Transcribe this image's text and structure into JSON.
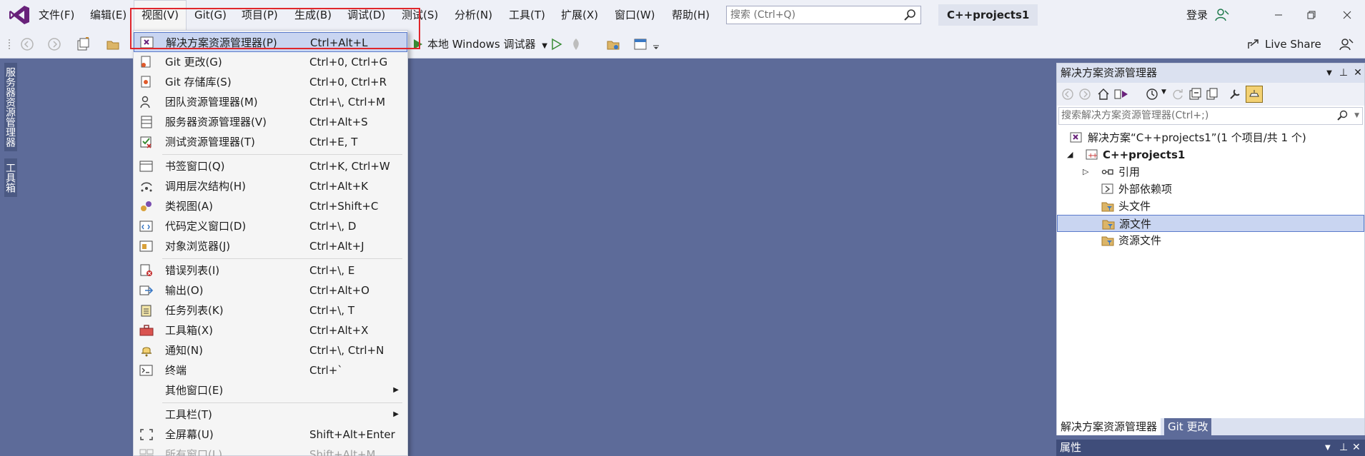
{
  "titlebar": {
    "menus": [
      "文件(F)",
      "编辑(E)",
      "视图(V)",
      "Git(G)",
      "项目(P)",
      "生成(B)",
      "调试(D)",
      "测试(S)",
      "分析(N)",
      "工具(T)",
      "扩展(X)",
      "窗口(W)",
      "帮助(H)"
    ],
    "search_placeholder": "搜索 (Ctrl+Q)",
    "project_name": "C++projects1",
    "signin": "登录"
  },
  "toolbar": {
    "debug_target": "本地 Windows 调试器",
    "live_share": "Live Share"
  },
  "left_tabs": [
    "服务器资源管理器",
    "工具箱"
  ],
  "view_menu": {
    "items": [
      {
        "label": "解决方案资源管理器(P)",
        "shortcut": "Ctrl+Alt+L",
        "icon": "solution-explorer-icon"
      },
      {
        "label": "Git 更改(G)",
        "shortcut": "Ctrl+0, Ctrl+G",
        "icon": "git-changes-icon"
      },
      {
        "label": "Git 存储库(S)",
        "shortcut": "Ctrl+0, Ctrl+R",
        "icon": "git-repository-icon"
      },
      {
        "label": "团队资源管理器(M)",
        "shortcut": "Ctrl+\\, Ctrl+M",
        "icon": "team-explorer-icon"
      },
      {
        "label": "服务器资源管理器(V)",
        "shortcut": "Ctrl+Alt+S",
        "icon": "server-explorer-icon"
      },
      {
        "label": "测试资源管理器(T)",
        "shortcut": "Ctrl+E, T",
        "icon": "test-explorer-icon"
      },
      {
        "label": "书签窗口(Q)",
        "shortcut": "Ctrl+K, Ctrl+W",
        "icon": "bookmark-icon"
      },
      {
        "label": "调用层次结构(H)",
        "shortcut": "Ctrl+Alt+K",
        "icon": "call-hierarchy-icon"
      },
      {
        "label": "类视图(A)",
        "shortcut": "Ctrl+Shift+C",
        "icon": "class-view-icon"
      },
      {
        "label": "代码定义窗口(D)",
        "shortcut": "Ctrl+\\, D",
        "icon": "code-definition-icon"
      },
      {
        "label": "对象浏览器(J)",
        "shortcut": "Ctrl+Alt+J",
        "icon": "object-browser-icon"
      },
      {
        "label": "错误列表(I)",
        "shortcut": "Ctrl+\\, E",
        "icon": "error-list-icon"
      },
      {
        "label": "输出(O)",
        "shortcut": "Ctrl+Alt+O",
        "icon": "output-icon"
      },
      {
        "label": "任务列表(K)",
        "shortcut": "Ctrl+\\, T",
        "icon": "task-list-icon"
      },
      {
        "label": "工具箱(X)",
        "shortcut": "Ctrl+Alt+X",
        "icon": "toolbox-icon"
      },
      {
        "label": "通知(N)",
        "shortcut": "Ctrl+\\, Ctrl+N",
        "icon": "bell-icon"
      },
      {
        "label": "终端",
        "shortcut": "Ctrl+`",
        "icon": "terminal-icon"
      },
      {
        "label": "其他窗口(E)",
        "shortcut": "",
        "icon": ""
      },
      {
        "label": "工具栏(T)",
        "shortcut": "",
        "icon": ""
      },
      {
        "label": "全屏幕(U)",
        "shortcut": "Shift+Alt+Enter",
        "icon": "fullscreen-icon"
      },
      {
        "label": "所有窗口(L)",
        "shortcut": "Shift+Alt+M",
        "icon": "all-windows-icon"
      }
    ]
  },
  "solution_explorer": {
    "title": "解决方案资源管理器",
    "search_placeholder": "搜索解决方案资源管理器(Ctrl+;)",
    "tree": [
      {
        "label": "解决方案“C++projects1”(1 个项目/共 1 个)"
      },
      {
        "label": "C++projects1"
      },
      {
        "label": "引用"
      },
      {
        "label": "外部依赖项"
      },
      {
        "label": "头文件"
      },
      {
        "label": "源文件"
      },
      {
        "label": "资源文件"
      }
    ],
    "tabs": [
      "解决方案资源管理器",
      "Git 更改"
    ]
  },
  "properties": {
    "title": "属性"
  },
  "colors": {
    "accent_purple": "#68217a",
    "highlight": "#c9d5f1",
    "annotation_red": "#e0262b",
    "workspace": "#5d6b99"
  }
}
